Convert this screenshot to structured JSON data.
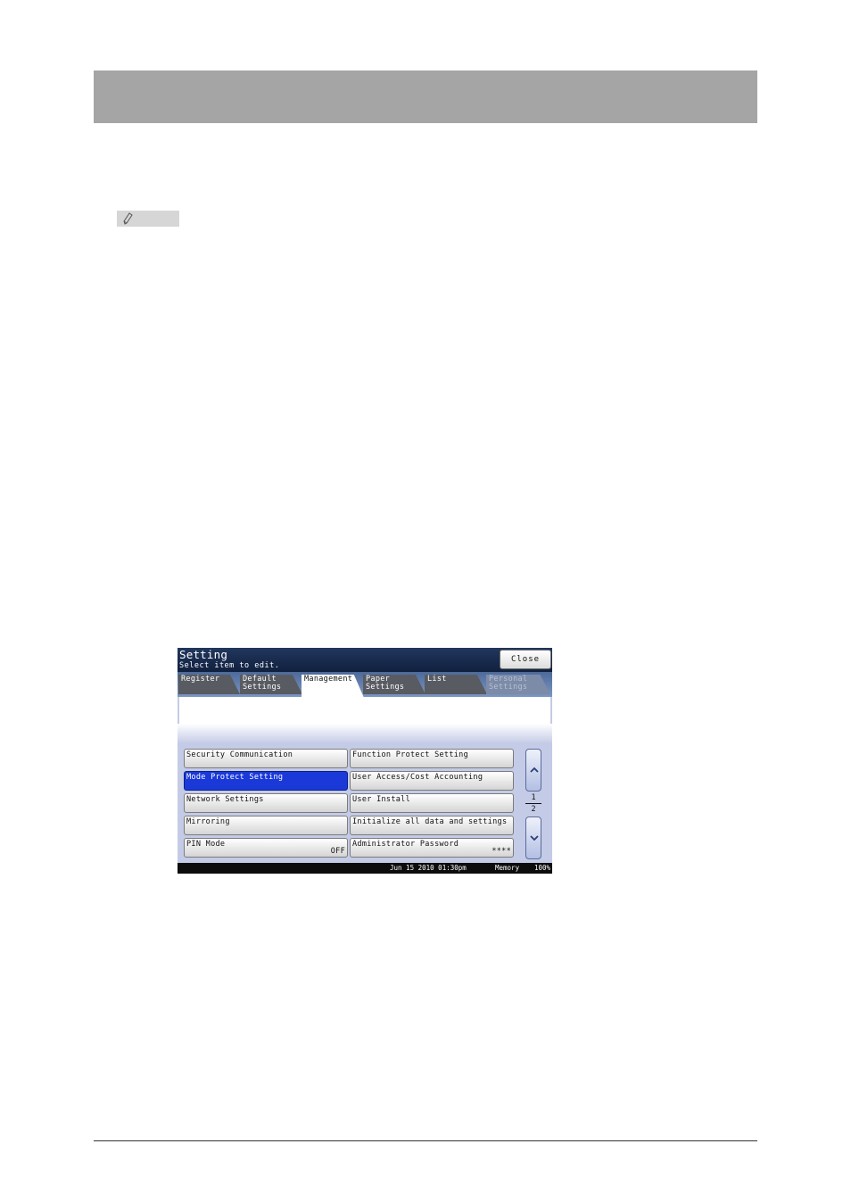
{
  "panel": {
    "title": "Setting",
    "subtitle": "Select item to edit.",
    "close_label": "Close",
    "tabs": [
      {
        "l1": "Register",
        "l2": ""
      },
      {
        "l1": "Default",
        "l2": "Settings"
      },
      {
        "l1": "Management",
        "l2": ""
      },
      {
        "l1": "Paper",
        "l2": "Settings"
      },
      {
        "l1": "List",
        "l2": ""
      },
      {
        "l1": "Personal",
        "l2": "Settings"
      }
    ],
    "active_tab": "Management",
    "items": [
      {
        "label": "Security Communication",
        "value": ""
      },
      {
        "label": "Function Protect Setting",
        "value": ""
      },
      {
        "label": "Mode Protect Setting",
        "value": ""
      },
      {
        "label": "User Access/Cost Accounting",
        "value": ""
      },
      {
        "label": "Network Settings",
        "value": ""
      },
      {
        "label": "User Install",
        "value": ""
      },
      {
        "label": "Mirroring",
        "value": ""
      },
      {
        "label": "Initialize all data and settings",
        "value": ""
      },
      {
        "label": "PIN Mode",
        "value": "OFF"
      },
      {
        "label": "Administrator Password",
        "value": "****"
      }
    ],
    "selected_item": "Mode Protect Setting",
    "page": {
      "current": "1",
      "total": "2"
    },
    "status": {
      "datetime": "Jun 15 2010 01:30pm",
      "memory_label": "Memory",
      "memory_value": "100%"
    }
  },
  "icons": {
    "note": "pencil-icon",
    "scroll_up": "chevron-up-icon",
    "scroll_down": "chevron-down-icon"
  },
  "colors": {
    "header_bar": "#a6a5a5",
    "selected": "#1a39d8",
    "titlebar": "#1a2c4f",
    "panel_bg": "#c4cbe6"
  }
}
